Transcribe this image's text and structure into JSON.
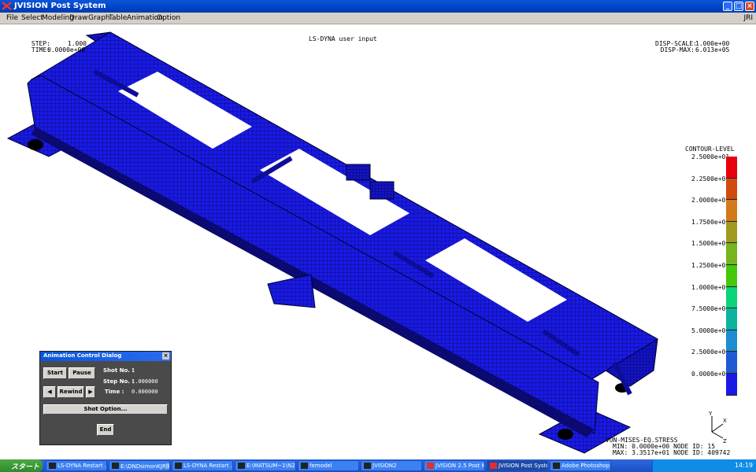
{
  "window": {
    "title": "JVISION Post System",
    "buttons": [
      "minimize",
      "maximize",
      "close"
    ]
  },
  "menubar": {
    "items": [
      "File",
      "Select",
      "Modeling",
      "Draw",
      "Graph",
      "Table",
      "Animation",
      "Option"
    ],
    "right_label": "JRI"
  },
  "hud": {
    "title": "LS-DYNA user input",
    "step_label": "STEP:",
    "step_value": "1.000",
    "time_label": "TIME:",
    "time_value": "0.0000e+00",
    "disp_scale_label": "DISP-SCALE:",
    "disp_scale_value": "1.000e+00",
    "disp_max_label": "DISP-MAX:",
    "disp_max_value": "6.013e+05",
    "contour_title": "CONTOUR-LEVEL",
    "result_name": "VON-MISES-EQ.STRESS",
    "min_line": "MIN: 0.0000e+00 NODE ID: 15",
    "max_line": "MAX: 3.3517e+01 NODE ID: 409742"
  },
  "legend": {
    "ticks": [
      "2.5000e+01",
      "2.2500e+01",
      "2.0000e+01",
      "1.7500e+01",
      "1.5000e+01",
      "1.2500e+01",
      "1.0000e+01",
      "7.5000e+00",
      "5.0000e+00",
      "2.5000e+00",
      "0.0000e+00"
    ],
    "colors": [
      "#e8000e",
      "#d24a10",
      "#d2791a",
      "#a09a1e",
      "#78b41e",
      "#46c80a",
      "#0cd27a",
      "#0cb4a0",
      "#1e8cd2",
      "#1e5ad2",
      "#1a1ae6"
    ]
  },
  "axis_triad": {
    "x": "X",
    "y": "Y",
    "z": "Z"
  },
  "dialog": {
    "title": "Animation Control Dialog",
    "start": "Start",
    "pause": "Pause",
    "rewind": "Rewind",
    "shot_no_label": "Shot No. :",
    "shot_no_value": "1",
    "step_no_label": "Step No. :",
    "step_no_value": "1.000000",
    "time_label": "Time :",
    "time_value": "0.000000",
    "shot_option": "Shot Option...",
    "end": "End"
  },
  "taskbar": {
    "start": "スタート",
    "items": [
      {
        "label": "LS-DYNA Restart ...",
        "active": false
      },
      {
        "label": "E:\\DNDsimonKJR開...",
        "active": false
      },
      {
        "label": "LS-DYNA Restart ...",
        "active": false
      },
      {
        "label": "E:\\MATSUM~1\\N2d...",
        "active": false
      },
      {
        "label": "femodel",
        "active": false
      },
      {
        "label": "JVISION2",
        "active": false
      },
      {
        "label": "JVISION 2.5 Post Me...",
        "active": false
      },
      {
        "label": "JVISION Post System",
        "active": true
      },
      {
        "label": "Adobe Photoshop",
        "active": false
      }
    ],
    "clock": "14:19"
  },
  "colors": {
    "titlebar": "#0a56d8",
    "mesh_blue": "#1a1ae6",
    "mesh_line": "#000040",
    "dialog_bg": "#4a4a4a"
  }
}
